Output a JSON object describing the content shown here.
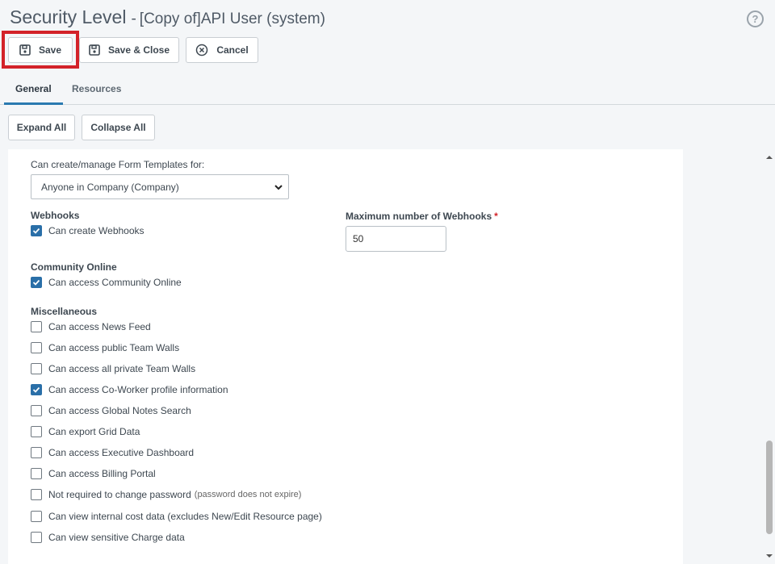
{
  "header": {
    "title": "Security Level",
    "separator": "-",
    "subtitle": "[Copy of]API User (system)",
    "help": "?"
  },
  "toolbar": {
    "save_label": "Save",
    "save_close_label": "Save & Close",
    "cancel_label": "Cancel"
  },
  "tabs": [
    {
      "label": "General",
      "active": true
    },
    {
      "label": "Resources",
      "active": false
    }
  ],
  "actions": {
    "expand_all": "Expand All",
    "collapse_all": "Collapse All"
  },
  "form": {
    "form_templates_label": "Can create/manage Form Templates for:",
    "form_templates_value": "Anyone in Company (Company)",
    "webhooks": {
      "title": "Webhooks",
      "can_create": "Can create Webhooks",
      "max_label": "Maximum number of Webhooks",
      "required_mark": "*",
      "max_value": "50"
    },
    "community": {
      "title": "Community Online",
      "can_access": "Can access Community Online"
    },
    "misc": {
      "title": "Miscellaneous",
      "items": [
        {
          "label": "Can access News Feed",
          "checked": false
        },
        {
          "label": "Can access public Team Walls",
          "checked": false
        },
        {
          "label": "Can access all private Team Walls",
          "checked": false
        },
        {
          "label": "Can access Co-Worker profile information",
          "checked": true
        },
        {
          "label": "Can access Global Notes Search",
          "checked": false
        },
        {
          "label": "Can export Grid Data",
          "checked": false
        },
        {
          "label": "Can access Executive Dashboard",
          "checked": false
        },
        {
          "label": "Can access Billing Portal",
          "checked": false
        },
        {
          "label": "Not required to change password",
          "note": "(password does not expire)",
          "checked": false
        },
        {
          "label": "Can view internal cost data (excludes New/Edit Resource page)",
          "checked": false
        },
        {
          "label": "Can view sensitive Charge data",
          "checked": false
        }
      ]
    }
  },
  "colors": {
    "accent": "#2a6fa8",
    "highlight": "#d32229"
  }
}
